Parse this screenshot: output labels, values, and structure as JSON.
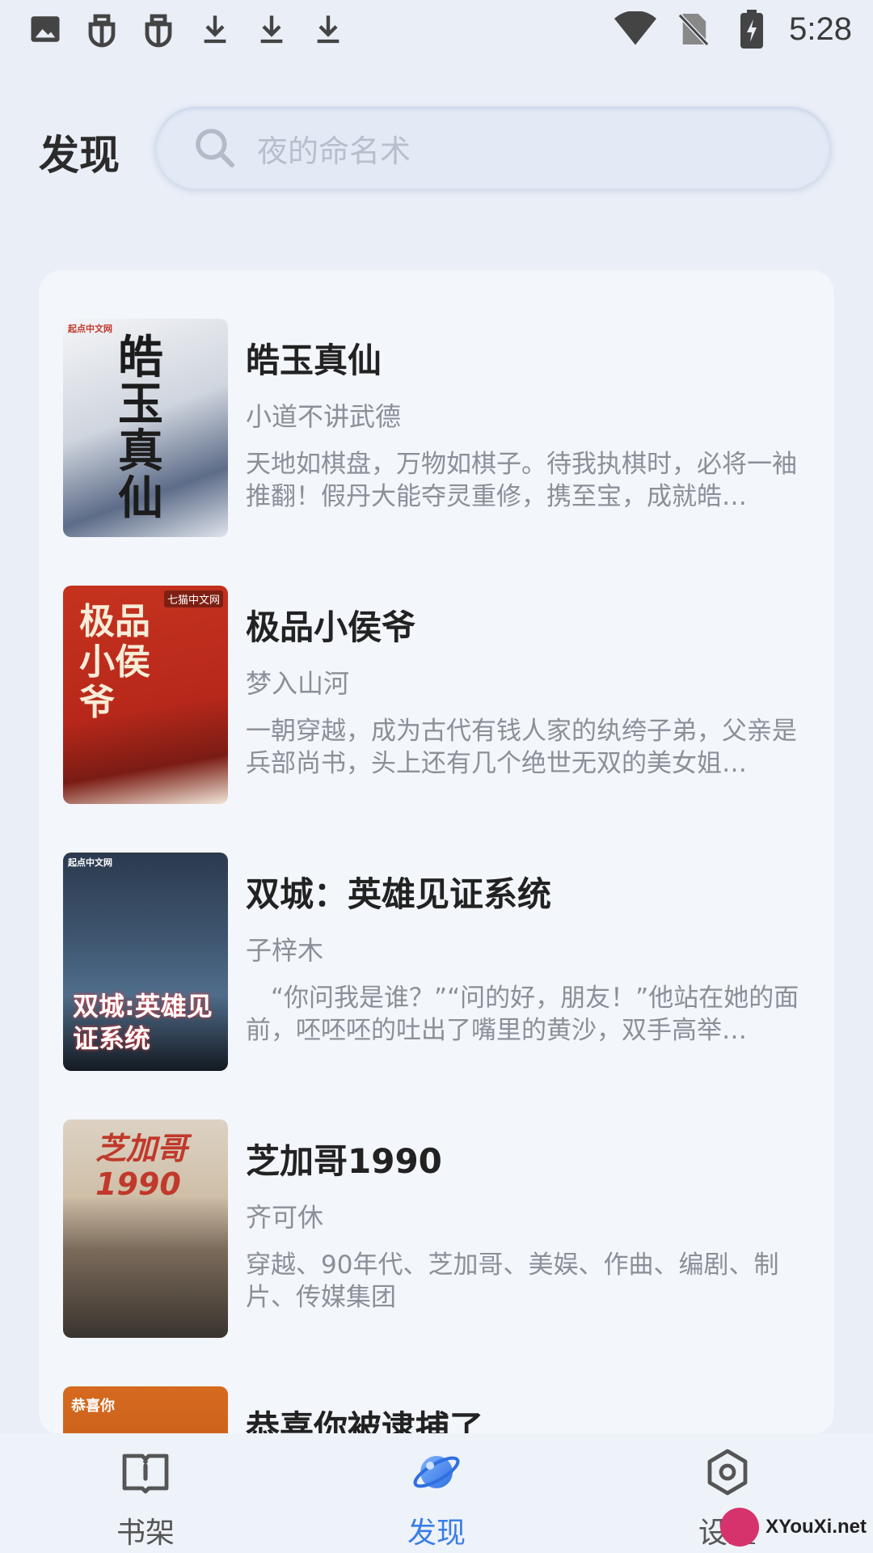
{
  "status_bar": {
    "time": "5:28",
    "left_icons": [
      "image-icon",
      "bug-icon",
      "bug-icon",
      "download-icon",
      "download-icon",
      "download-icon"
    ],
    "right_icons": [
      "wifi-icon",
      "no-sim-icon",
      "battery-charging-icon"
    ]
  },
  "header": {
    "title": "发现",
    "search_placeholder": "夜的命名术"
  },
  "books": [
    {
      "title": "皓玉真仙",
      "author": "小道不讲武德",
      "description": "天地如棋盘，万物如棋子。待我执棋时，必将一袖推翻！假丹大能夺灵重修，携至宝，成就皓…",
      "cover_text": "皓玉真仙",
      "cover_badge": "起点中文网"
    },
    {
      "title": "极品小侯爷",
      "author": "梦入山河",
      "description": "一朝穿越，成为古代有钱人家的纨绔子弟，父亲是兵部尚书，头上还有几个绝世无双的美女姐…",
      "cover_text": "极品小侯爷",
      "cover_badge": "七猫中文网"
    },
    {
      "title": "双城：英雄见证系统",
      "author": "子梓木",
      "description": "　“你问我是谁？”“问的好，朋友！”他站在她的面前，呸呸呸的吐出了嘴里的黄沙，双手高举…",
      "cover_text": "双城:英雄见证系统",
      "cover_badge": "起点中文网"
    },
    {
      "title": "芝加哥1990",
      "author": "齐可休",
      "description": "穿越、90年代、芝加哥、美娱、作曲、编剧、制片、传媒集团",
      "cover_text": "芝加哥1990",
      "cover_badge": ""
    },
    {
      "title": "恭喜你被逮捕了",
      "author": "",
      "description": "",
      "cover_text": "恭喜你",
      "cover_badge": ""
    }
  ],
  "bottom_nav": {
    "items": [
      {
        "label": "书架",
        "icon": "book-icon"
      },
      {
        "label": "发现",
        "icon": "planet-icon"
      },
      {
        "label": "设置",
        "icon": "settings-icon"
      }
    ],
    "active": "发现"
  },
  "watermark": "XYouXi.net",
  "colors": {
    "accent": "#3a7ee6",
    "background": "#e9eef7",
    "card": "#f3f6fb"
  }
}
